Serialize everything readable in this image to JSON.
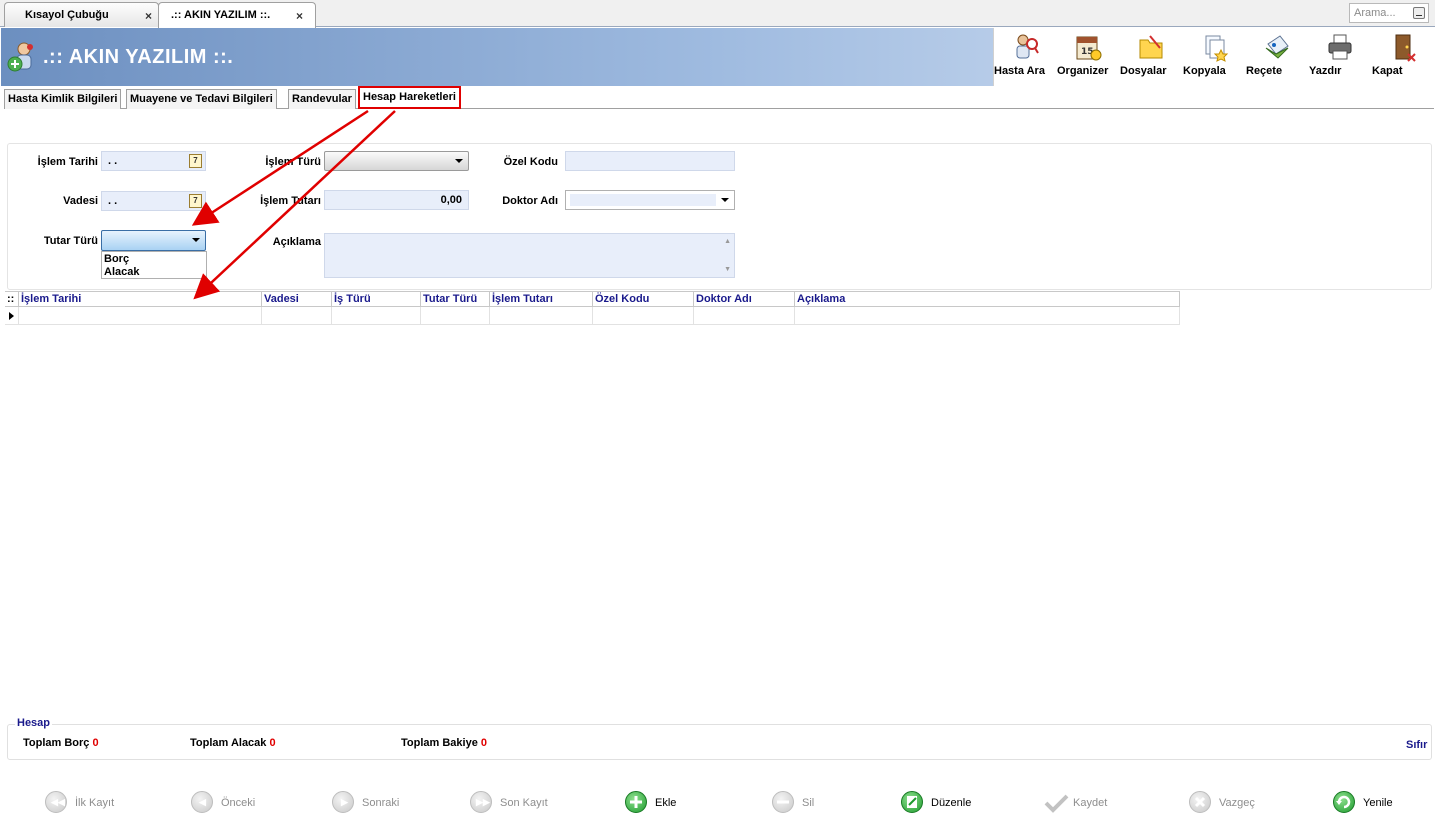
{
  "doc_tabs": [
    {
      "label": "Kısayol Çubuğu",
      "close": "×"
    },
    {
      "label": ".:: AKIN YAZILIM ::.",
      "close": "×"
    }
  ],
  "search": {
    "placeholder": "Arama..."
  },
  "header": {
    "title": ".:: AKIN YAZILIM ::."
  },
  "toolbar": {
    "hasta_ara": "Hasta Ara",
    "organizer": "Organizer",
    "dosyalar": "Dosyalar",
    "kopyala": "Kopyala",
    "recete": "Reçete",
    "yazdir": "Yazdır",
    "kapat": "Kapat"
  },
  "tabs": [
    "Hasta Kimlik Bilgileri",
    "Muayene ve Tedavi Bilgileri",
    "Randevular",
    "Hesap Hareketleri"
  ],
  "form": {
    "islem_tarihi_label": "İşlem Tarihi",
    "islem_tarihi_value": ". .",
    "vadesi_label": "Vadesi",
    "vadesi_value": ". .",
    "tutar_turu_label": "Tutar Türü",
    "tutar_turu_options": [
      "Borç",
      "Alacak"
    ],
    "islem_turu_label": "İşlem Türü",
    "islem_tutari_label": "İşlem Tutarı",
    "islem_tutari_value": "0,00",
    "aciklama_label": "Açıklama",
    "ozel_kodu_label": "Özel Kodu",
    "doktor_adi_label": "Doktor Adı",
    "calendar_glyph": "7"
  },
  "grid": {
    "corner": "::",
    "columns": [
      "İşlem Tarihi",
      "Vadesi",
      "İş Türü",
      "Tutar Türü",
      "İşlem Tutarı",
      "Özel Kodu",
      "Doktor Adı",
      "Açıklama"
    ]
  },
  "summary": {
    "title": "Hesap",
    "toplam_borc_label": "Toplam Borç",
    "toplam_borc_value": "0",
    "toplam_alacak_label": "Toplam Alacak",
    "toplam_alacak_value": "0",
    "toplam_bakiye_label": "Toplam Bakiye",
    "toplam_bakiye_value": "0",
    "reset": "Sıfır"
  },
  "nav": {
    "ilk": "İlk Kayıt",
    "onceki": "Önceki",
    "sonraki": "Sonraki",
    "son": "Son Kayıt",
    "ekle": "Ekle",
    "sil": "Sil",
    "duzenle": "Düzenle",
    "kaydet": "Kaydet",
    "vazgec": "Vazgeç",
    "yenile": "Yenile"
  },
  "colors": {
    "highlight": "#e00000",
    "header_blue": "#6c8fc0",
    "grid_header_text": "#1a1a8c"
  }
}
